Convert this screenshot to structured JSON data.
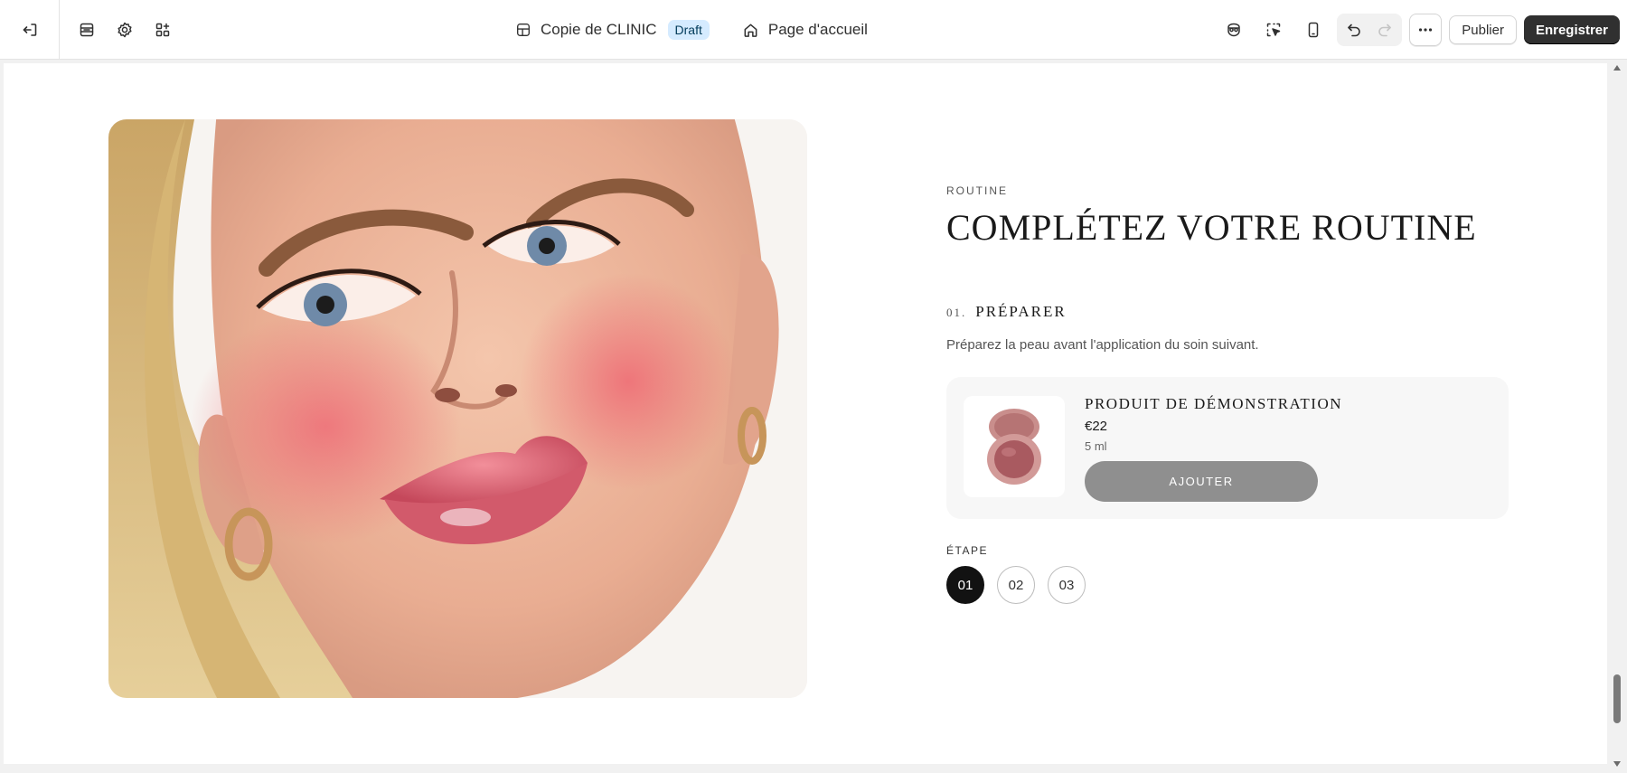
{
  "topbar": {
    "theme_name": "Copie de CLINIC",
    "status_badge": "Draft",
    "page_selector": "Page d'accueil",
    "publish_label": "Publier",
    "save_label": "Enregistrer",
    "left_icons": [
      "exit-icon",
      "sections-icon",
      "gear-icon",
      "apps-icon"
    ],
    "right_icons": [
      "inspector-icon",
      "select-cursor-icon",
      "mobile-icon",
      "undo-icon",
      "redo-icon",
      "more-icon"
    ]
  },
  "section": {
    "eyebrow": "ROUTINE",
    "title": "COMPLÉTEZ VOTRE ROUTINE",
    "step_number": "01.",
    "step_title": "PRÉPARER",
    "step_description": "Préparez la peau avant l'application du soin suivant.",
    "product": {
      "name": "PRODUIT DE DÉMONSTRATION",
      "price": "€22",
      "size": "5 ml",
      "button_label": "AJOUTER"
    },
    "step_label": "ÉTAPE",
    "steps": [
      {
        "label": "01",
        "active": true
      },
      {
        "label": "02",
        "active": false
      },
      {
        "label": "03",
        "active": false
      }
    ]
  },
  "colors": {
    "accent_dark": "#303030",
    "badge_bg": "#d5ebff",
    "add_button": "#8f8f8f",
    "active_step": "#121212"
  }
}
